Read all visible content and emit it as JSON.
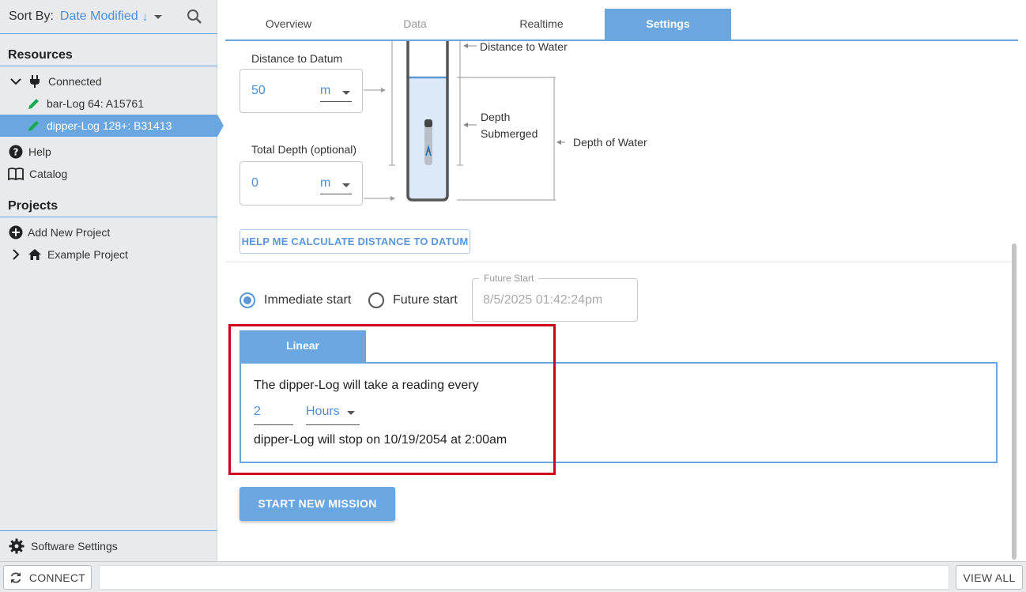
{
  "sidebar": {
    "sort_label": "Sort By:",
    "sort_value": "Date Modified",
    "resources_title": "Resources",
    "connected_label": "Connected",
    "devices": [
      "bar-Log 64: A15761",
      "dipper-Log 128+: B31413"
    ],
    "help_label": "Help",
    "catalog_label": "Catalog",
    "projects_title": "Projects",
    "add_project_label": "Add New Project",
    "example_project_label": "Example Project",
    "software_settings_label": "Software Settings"
  },
  "tabs": [
    "Overview",
    "Data",
    "Realtime",
    "Settings"
  ],
  "settings": {
    "distance_to_datum_label": "Distance to Datum",
    "distance_to_datum_value": "50",
    "distance_unit": "m",
    "total_depth_label": "Total Depth (optional)",
    "total_depth_value": "0",
    "total_depth_unit": "m",
    "diagram": {
      "distance_to_water": "Distance to Water",
      "depth_submerged_1": "Depth",
      "depth_submerged_2": "Submerged",
      "depth_of_water": "Depth of Water"
    },
    "help_calc_button": "HELP ME CALCULATE DISTANCE TO DATUM",
    "immediate_start_label": "Immediate start",
    "future_start_label": "Future start",
    "future_start_legend": "Future Start",
    "future_start_value": "8/5/2025 01:42:24pm",
    "linear_tab": "Linear",
    "reading_text": "The dipper-Log will take a reading every",
    "interval_value": "2",
    "interval_unit": "Hours",
    "stop_text": "dipper-Log will stop on 10/19/2054 at 2:00am",
    "start_mission_button": "START NEW MISSION"
  },
  "footer": {
    "connect_label": "CONNECT",
    "view_all_label": "VIEW ALL"
  },
  "colors": {
    "accent": "#6aa6e0",
    "highlight_border": "#d0021b",
    "sidebar_bg": "#e8eaed"
  }
}
